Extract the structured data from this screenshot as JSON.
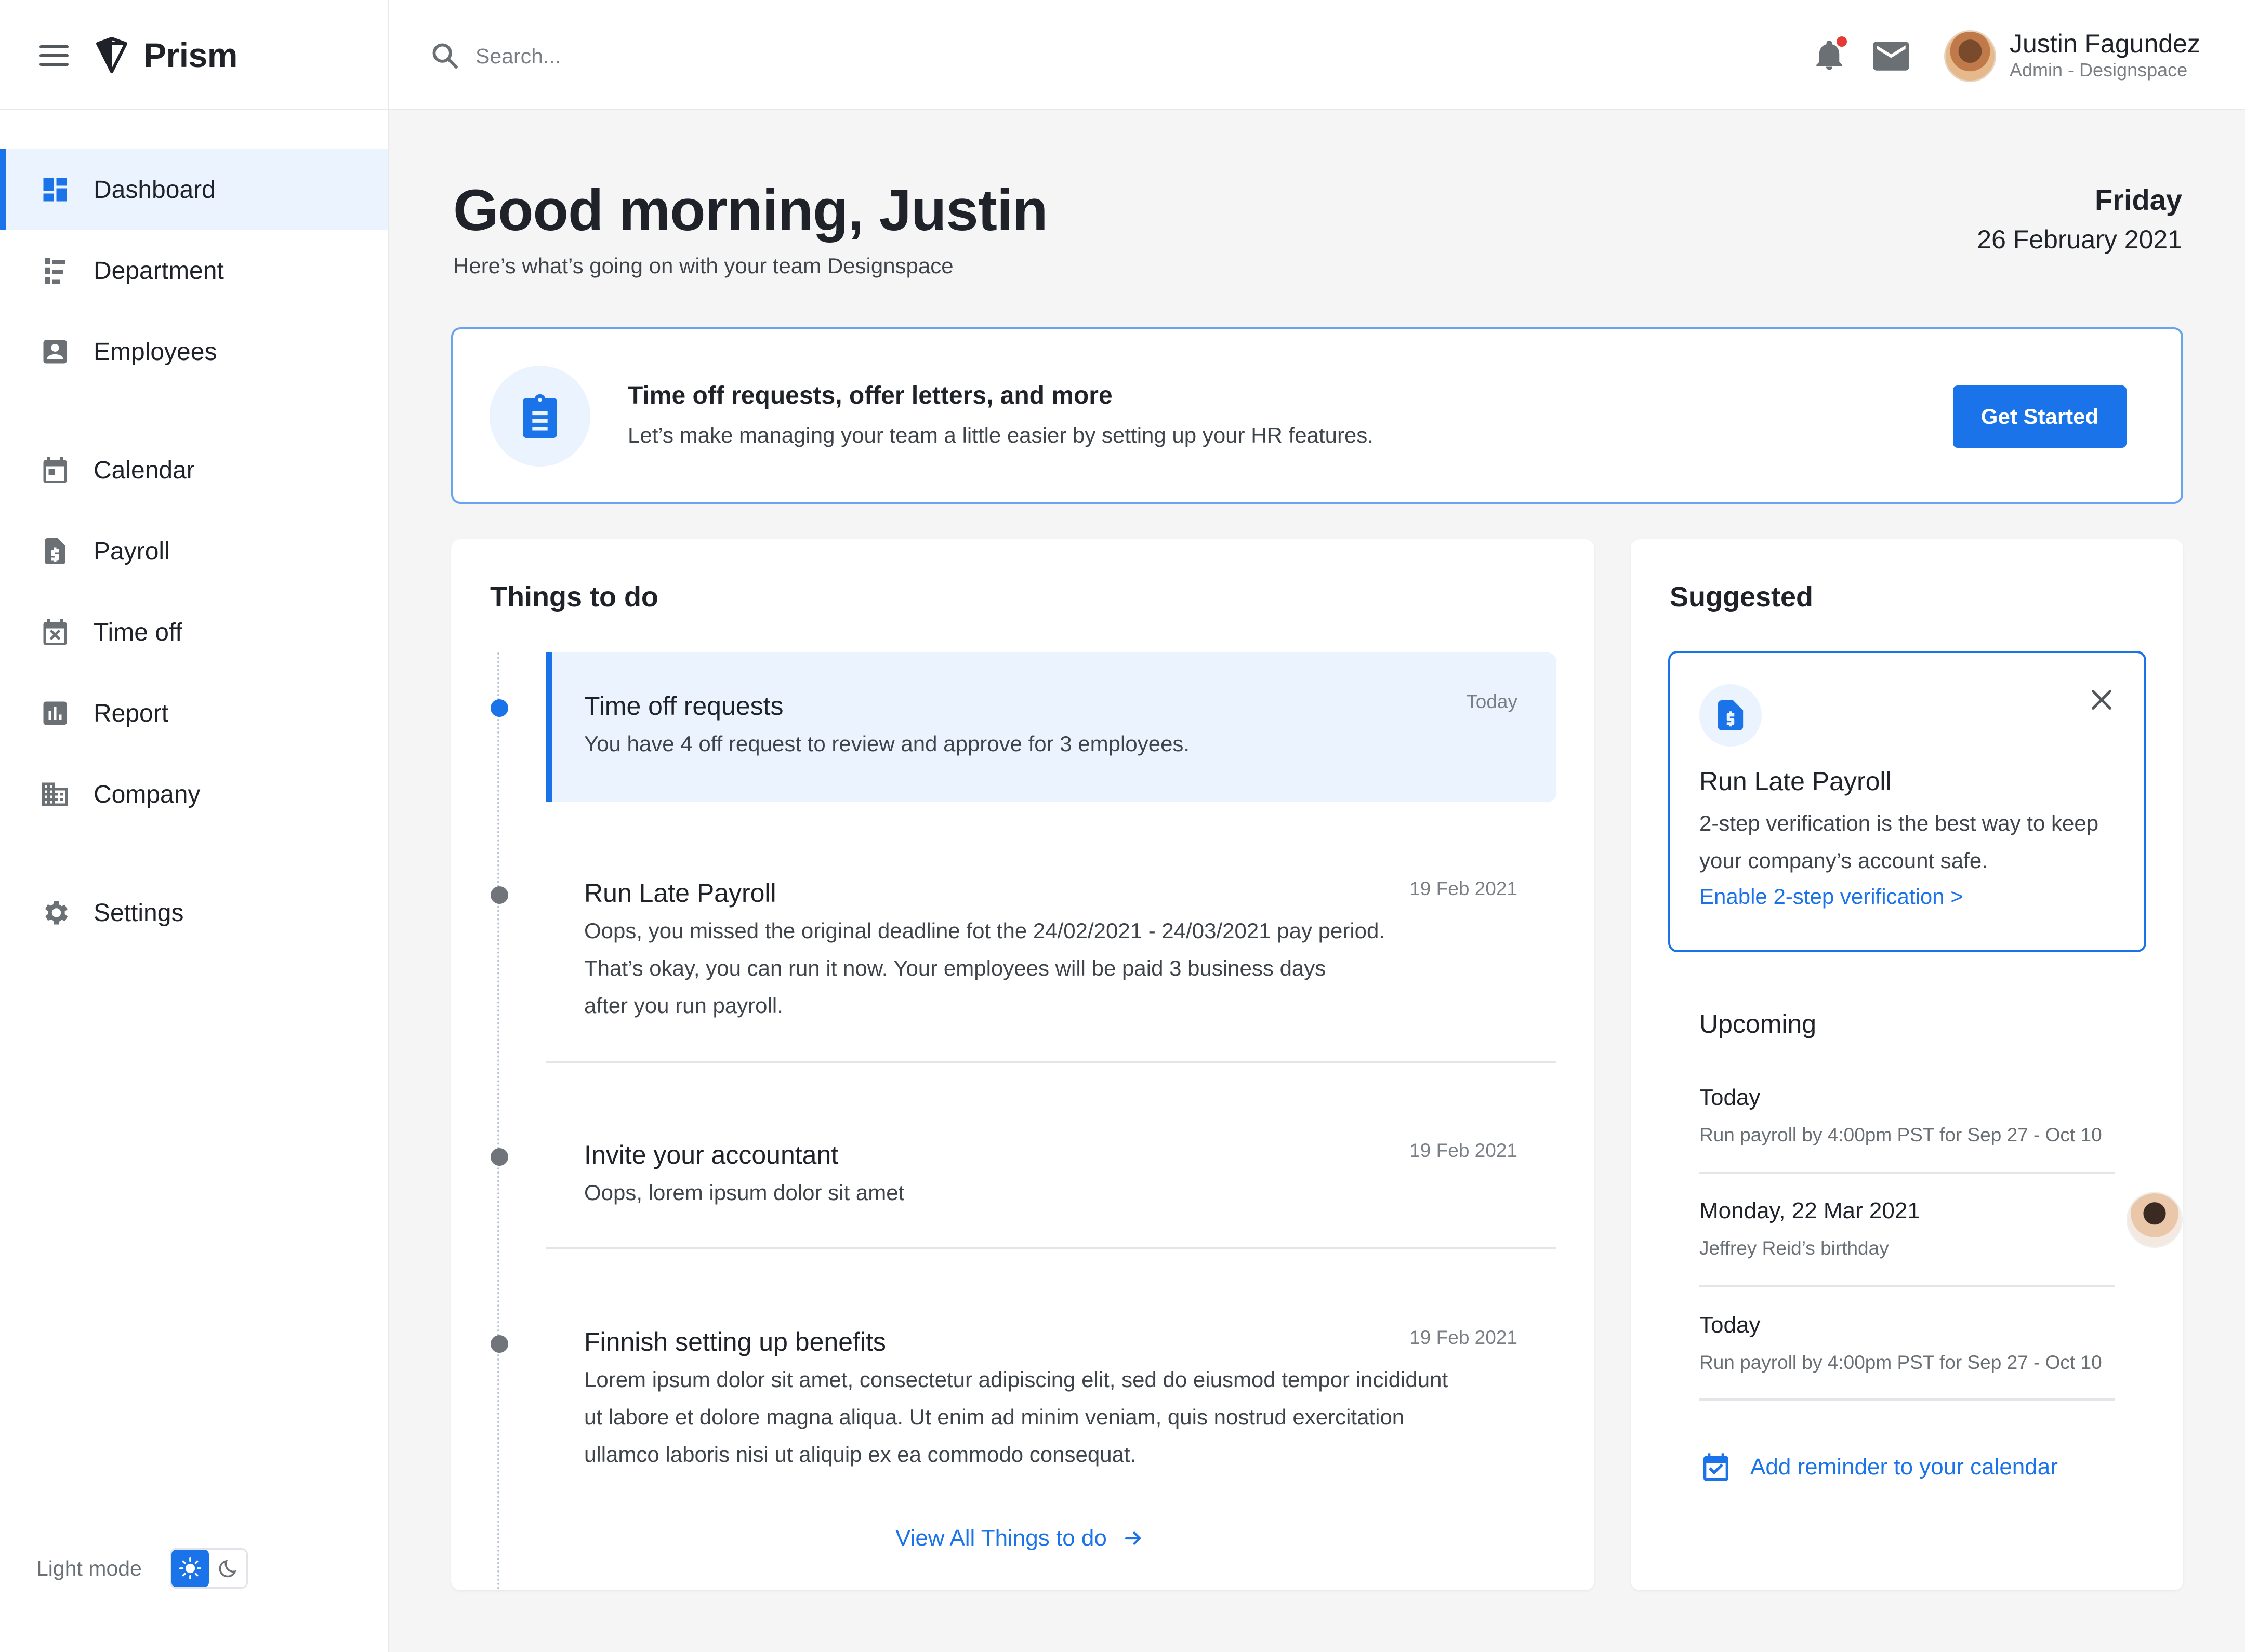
{
  "app": {
    "name": "Prism"
  },
  "sidebar": {
    "items": [
      {
        "label": "Dashboard",
        "icon": "dashboard-icon",
        "active": true
      },
      {
        "label": "Department",
        "icon": "department-icon"
      },
      {
        "label": "Employees",
        "icon": "employees-icon"
      },
      {
        "label": "Calendar",
        "icon": "calendar-icon"
      },
      {
        "label": "Payroll",
        "icon": "payroll-icon"
      },
      {
        "label": "Time off",
        "icon": "time-off-icon"
      },
      {
        "label": "Report",
        "icon": "report-icon"
      },
      {
        "label": "Company",
        "icon": "company-icon"
      },
      {
        "label": "Settings",
        "icon": "settings-icon"
      }
    ],
    "theme": {
      "label": "Light mode",
      "selected": "light"
    }
  },
  "header": {
    "search": {
      "placeholder": "Search..."
    },
    "notifications": {
      "has_unread": true
    },
    "user": {
      "name": "Justin Fagundez",
      "role": "Admin - Designspace"
    }
  },
  "main": {
    "greeting": "Good morning, Justin",
    "subtitle": "Here’s what’s going on with your team Designspace",
    "day": "Friday",
    "date": "26 February 2021",
    "banner": {
      "title": "Time off requests, offer letters, and more",
      "description": "Let’s make managing your team a little easier by setting up your HR features.",
      "button": "Get Started"
    },
    "todo": {
      "title": "Things to do",
      "items": [
        {
          "title": "Time off requests",
          "date": "Today",
          "body": [
            "You have 4 off request to review and approve for 3 employees."
          ]
        },
        {
          "title": "Run Late Payroll",
          "date": "19 Feb 2021",
          "body": [
            "Oops, you missed the original deadline fot the 24/02/2021 - 24/03/2021 pay period.",
            "That’s okay, you can run it now. Your employees will be paid 3 business days",
            "after you run payroll."
          ]
        },
        {
          "title": "Invite your accountant",
          "date": "19 Feb 2021",
          "body": [
            "Oops, lorem ipsum dolor sit amet"
          ]
        },
        {
          "title": "Finnish setting up benefits",
          "date": "19 Feb 2021",
          "body": [
            "Lorem ipsum dolor sit amet, consectetur adipiscing elit, sed do eiusmod tempor incididunt",
            "ut labore et dolore magna aliqua. Ut enim ad minim veniam, quis nostrud exercitation",
            "ullamco laboris nisi ut aliquip ex ea commodo consequat."
          ]
        }
      ],
      "view_all": "View All Things to do"
    },
    "suggested": {
      "title": "Suggested",
      "card": {
        "title": "Run Late Payroll",
        "description": "2-step verification is the best way to keep your company’s account safe.",
        "link": "Enable 2-step verification >"
      },
      "upcoming": {
        "title": "Upcoming",
        "items": [
          {
            "title": "Today",
            "subtitle": "Run payroll by 4:00pm PST for Sep 27 - Oct 10"
          },
          {
            "title": "Monday, 22 Mar 2021",
            "subtitle": "Jeffrey Reid’s birthday",
            "has_avatar": true
          },
          {
            "title": "Today",
            "subtitle": "Run payroll by 4:00pm PST for Sep 27 - Oct 10"
          }
        ],
        "reminder": "Add reminder to your calendar"
      }
    }
  },
  "colors": {
    "accent": "#1a73e8",
    "accent_light": "#ebf3fe",
    "alert": "#e53935"
  }
}
